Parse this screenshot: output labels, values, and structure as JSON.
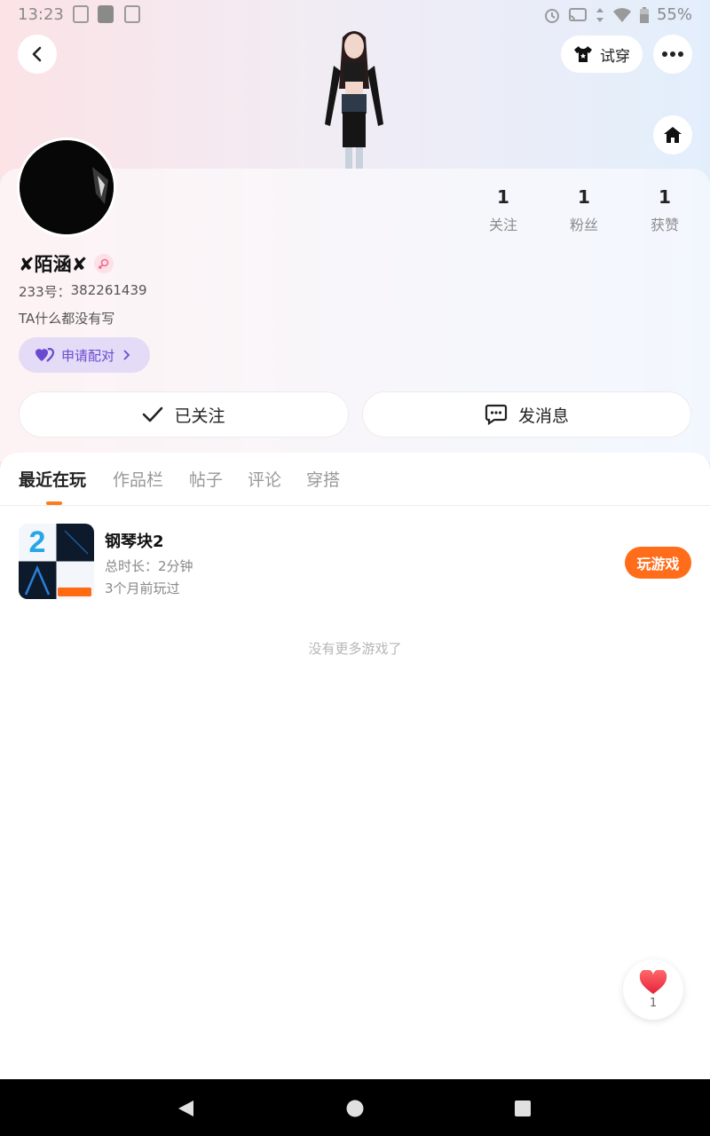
{
  "status_bar": {
    "time": "13:23",
    "battery": "55%"
  },
  "header": {
    "try_on_label": "试穿"
  },
  "stats": [
    {
      "num": "1",
      "label": "关注"
    },
    {
      "num": "1",
      "label": "粉丝"
    },
    {
      "num": "1",
      "label": "获赞"
    }
  ],
  "profile": {
    "nickname": "✘陌涵✘",
    "id_label": "233号：",
    "id_value": "382261439",
    "bio": "TA什么都没有写",
    "pair_label": "申请配对"
  },
  "actions": {
    "follow_label": "已关注",
    "message_label": "发消息"
  },
  "tabs": [
    {
      "label": "最近在玩"
    },
    {
      "label": "作品栏"
    },
    {
      "label": "帖子"
    },
    {
      "label": "评论"
    },
    {
      "label": "穿搭"
    }
  ],
  "games": [
    {
      "title": "钢琴块2",
      "duration_label": "总时长：",
      "duration_value": "2分钟",
      "last_played": "3个月前玩过",
      "play_label": "玩游戏",
      "icon_number": "2"
    }
  ],
  "list_end_text": "没有更多游戏了",
  "like": {
    "count": "1"
  },
  "colors": {
    "accent_orange": "#ff6d1b",
    "pair_purple": "#6b4ad0",
    "pair_bg": "#e4dcf7"
  }
}
